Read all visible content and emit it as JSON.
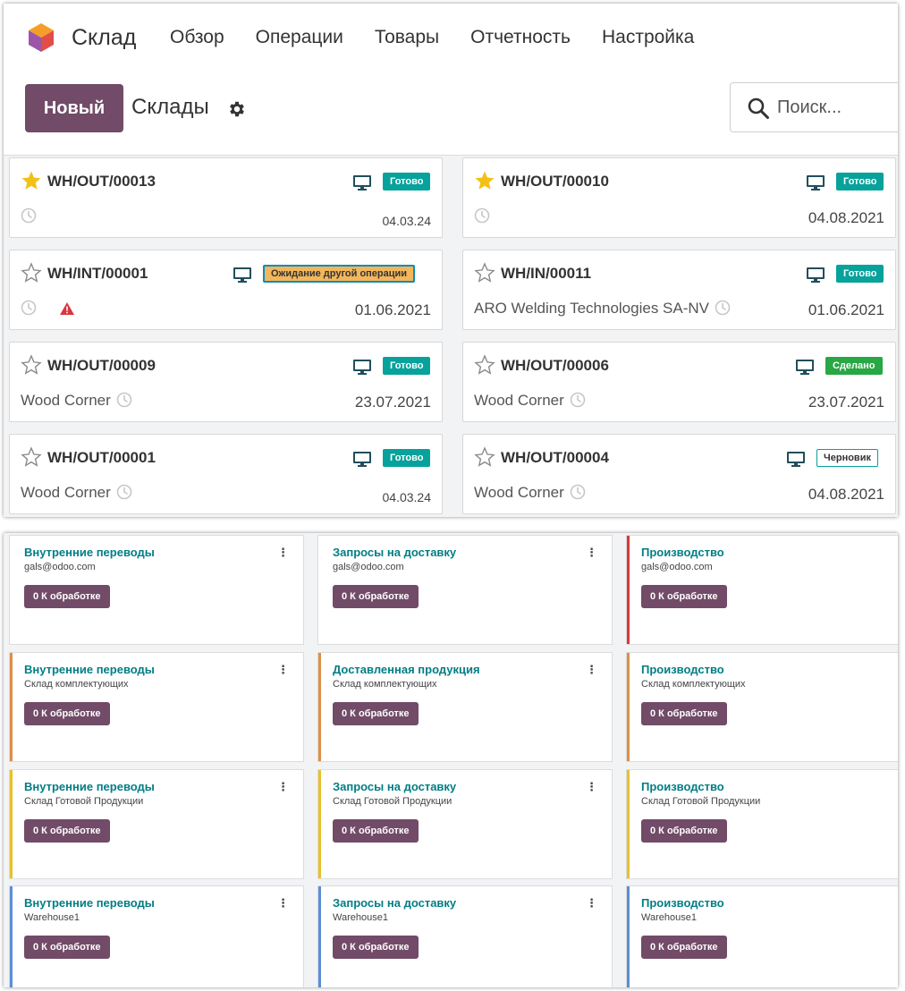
{
  "navbar": {
    "app_name": "Склад",
    "menu": [
      "Обзор",
      "Операции",
      "Товары",
      "Отчетность",
      "Настройка"
    ]
  },
  "control": {
    "new_label": "Новый",
    "title": "Склады",
    "search_placeholder": "Поиск..."
  },
  "transfers": [
    {
      "ref": "WH/OUT/00013",
      "starred": true,
      "status": "Готово",
      "status_kind": "ready",
      "partner": "",
      "date": "04.03.24",
      "warning": false
    },
    {
      "ref": "WH/OUT/00010",
      "starred": true,
      "status": "Готово",
      "status_kind": "ready",
      "partner": "",
      "date": "04.08.2021",
      "warning": false
    },
    {
      "ref": "WH/INT/00001",
      "starred": false,
      "status": "Ожидание другой операции",
      "status_kind": "waiting",
      "partner": "",
      "date": "01.06.2021",
      "warning": true
    },
    {
      "ref": "WH/IN/00011",
      "starred": false,
      "status": "Готово",
      "status_kind": "ready",
      "partner": "ARO Welding Technologies SA-NV",
      "date": "01.06.2021",
      "warning": false
    },
    {
      "ref": "WH/OUT/00009",
      "starred": false,
      "status": "Готово",
      "status_kind": "ready",
      "partner": "Wood Corner",
      "date": "23.07.2021",
      "warning": false
    },
    {
      "ref": "WH/OUT/00006",
      "starred": false,
      "status": "Сделано",
      "status_kind": "done",
      "partner": "Wood Corner",
      "date": "23.07.2021",
      "warning": false
    },
    {
      "ref": "WH/OUT/00001",
      "starred": false,
      "status": "Готово",
      "status_kind": "ready",
      "partner": "Wood Corner",
      "date": "04.03.24",
      "warning": false
    },
    {
      "ref": "WH/OUT/00004",
      "starred": false,
      "status": "Черновик",
      "status_kind": "draft",
      "partner": "Wood Corner",
      "date": "04.08.2021",
      "warning": false
    }
  ],
  "operations": [
    {
      "title": "Внутренние переводы",
      "warehouse": "gals@odoo.com",
      "button": "0 К обработке",
      "color": ""
    },
    {
      "title": "Запросы на доставку",
      "warehouse": "gals@odoo.com",
      "button": "0 К обработке",
      "color": ""
    },
    {
      "title": "Производство",
      "warehouse": "gals@odoo.com",
      "button": "0 К обработке",
      "color": "#d9363e"
    },
    {
      "title": "Внутренние переводы",
      "warehouse": "Склад комплектующих",
      "button": "0 К обработке",
      "color": "#dd8f48"
    },
    {
      "title": "Доставленная продукция",
      "warehouse": "Склад комплектующих",
      "button": "0 К обработке",
      "color": "#dd8f48"
    },
    {
      "title": "Производство",
      "warehouse": "Склад комплектующих",
      "button": "0 К обработке",
      "color": "#dd8f48"
    },
    {
      "title": "Внутренние переводы",
      "warehouse": "Склад Готовой Продукции",
      "button": "0 К обработке",
      "color": "#e8c029"
    },
    {
      "title": "Запросы на доставку",
      "warehouse": "Склад Готовой Продукции",
      "button": "0 К обработке",
      "color": "#e8c029"
    },
    {
      "title": "Производство",
      "warehouse": "Склад Готовой Продукции",
      "button": "0 К обработке",
      "color": "#e8c029"
    },
    {
      "title": "Внутренние переводы",
      "warehouse": "Warehouse1",
      "button": "0 К обработке",
      "color": "#5b8ed6"
    },
    {
      "title": "Запросы на доставку",
      "warehouse": "Warehouse1",
      "button": "0 К обработке",
      "color": "#5b8ed6"
    },
    {
      "title": "Производство",
      "warehouse": "Warehouse1",
      "button": "0 К обработке",
      "color": "#5b8ed6"
    }
  ],
  "icons": {
    "logo": "odoo-inventory-logo",
    "gear": "gear-icon",
    "search": "search-icon",
    "star": "star-icon",
    "monitor": "monitor-icon",
    "clock": "clock-icon",
    "warning": "warning-icon",
    "dots": "kebab-menu-icon"
  },
  "colors": {
    "primary": "#714b67",
    "teal": "#017e84",
    "ready": "#06a29b",
    "done": "#28a745",
    "waiting": "#f3b65a",
    "star": "#f3c016"
  }
}
